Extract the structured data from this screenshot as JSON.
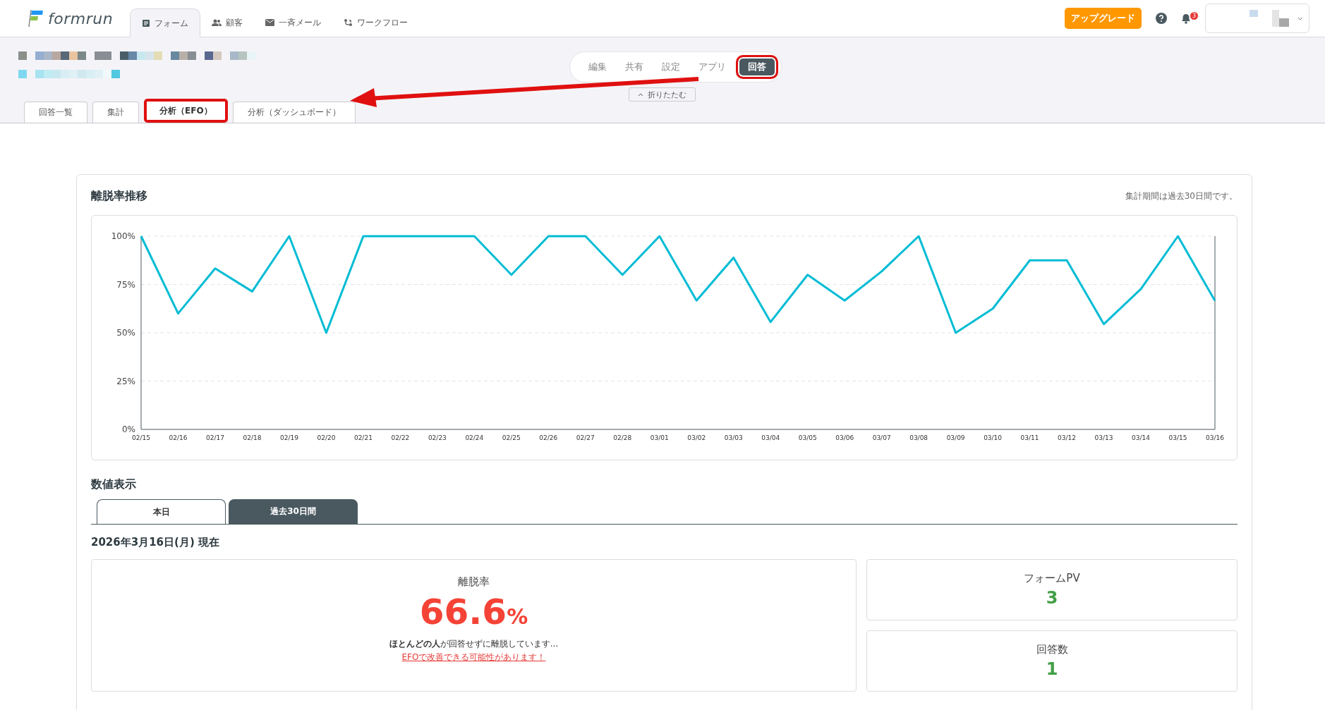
{
  "app": {
    "logo": "formrun",
    "nav": [
      {
        "label": "フォーム",
        "selected": true
      },
      {
        "label": "顧客",
        "selected": false
      },
      {
        "label": "一斉メール",
        "selected": false
      },
      {
        "label": "ワークフロー",
        "selected": false
      }
    ],
    "upgrade": "アップグレード",
    "notifications": "3"
  },
  "form_header": {
    "mode_tabs": [
      {
        "label": "編集",
        "selected": false
      },
      {
        "label": "共有",
        "selected": false
      },
      {
        "label": "設定",
        "selected": false
      },
      {
        "label": "アプリ",
        "selected": false
      },
      {
        "label": "回答",
        "selected": true
      }
    ],
    "collapse": "折りたたむ",
    "sub_tabs": [
      {
        "label": "回答一覧",
        "selected": false
      },
      {
        "label": "集計",
        "selected": false
      },
      {
        "label": "分析（EFO）",
        "selected": true
      },
      {
        "label": "分析（ダッシュボード）",
        "selected": false
      }
    ]
  },
  "trend": {
    "title": "離脱率推移",
    "note": "集計期間は過去30日間です。",
    "chart_data": {
      "type": "line",
      "categories": [
        "02/15",
        "02/16",
        "02/17",
        "02/18",
        "02/19",
        "02/20",
        "02/21",
        "02/22",
        "02/23",
        "02/24",
        "02/25",
        "02/26",
        "02/27",
        "02/28",
        "03/01",
        "03/02",
        "03/03",
        "03/04",
        "03/05",
        "03/06",
        "03/07",
        "03/08",
        "03/09",
        "03/10",
        "03/11",
        "03/12",
        "03/13",
        "03/14",
        "03/15",
        "03/16"
      ],
      "grid": true,
      "series": [
        {
          "color": "#00bcd4",
          "values": [
            100,
            60,
            83.3,
            71.4,
            100,
            50,
            100,
            100,
            100,
            100,
            80,
            100,
            100,
            80,
            100,
            66.7,
            88.9,
            55.6,
            80,
            66.7,
            81.8,
            100,
            50,
            62.5,
            87.5,
            87.5,
            54.5,
            72.7,
            100,
            66.6
          ]
        }
      ],
      "ylim": [
        0,
        100
      ],
      "yticks": [
        {
          "value": 0,
          "label": "0%"
        },
        {
          "value": 25,
          "label": "25%"
        },
        {
          "value": 50,
          "label": "50%"
        },
        {
          "value": 75,
          "label": "75%"
        },
        {
          "value": 100,
          "label": "100%"
        }
      ]
    }
  },
  "numbers": {
    "title": "数値表示",
    "period_tabs": [
      {
        "label": "本日",
        "selected": true
      },
      {
        "label": "過去30日間",
        "selected": false
      }
    ],
    "as_of": "2026年3月16日(月) 現在",
    "main": {
      "label": "離脱率",
      "value": "66.6",
      "unit": "%",
      "message": "**ほとんどの人**が回答せずに離脱しています...",
      "link": "EFOで改善できる可能性があります！"
    },
    "stats": [
      {
        "label": "フォームPV",
        "value": "3"
      },
      {
        "label": "回答数",
        "value": "1"
      }
    ]
  }
}
